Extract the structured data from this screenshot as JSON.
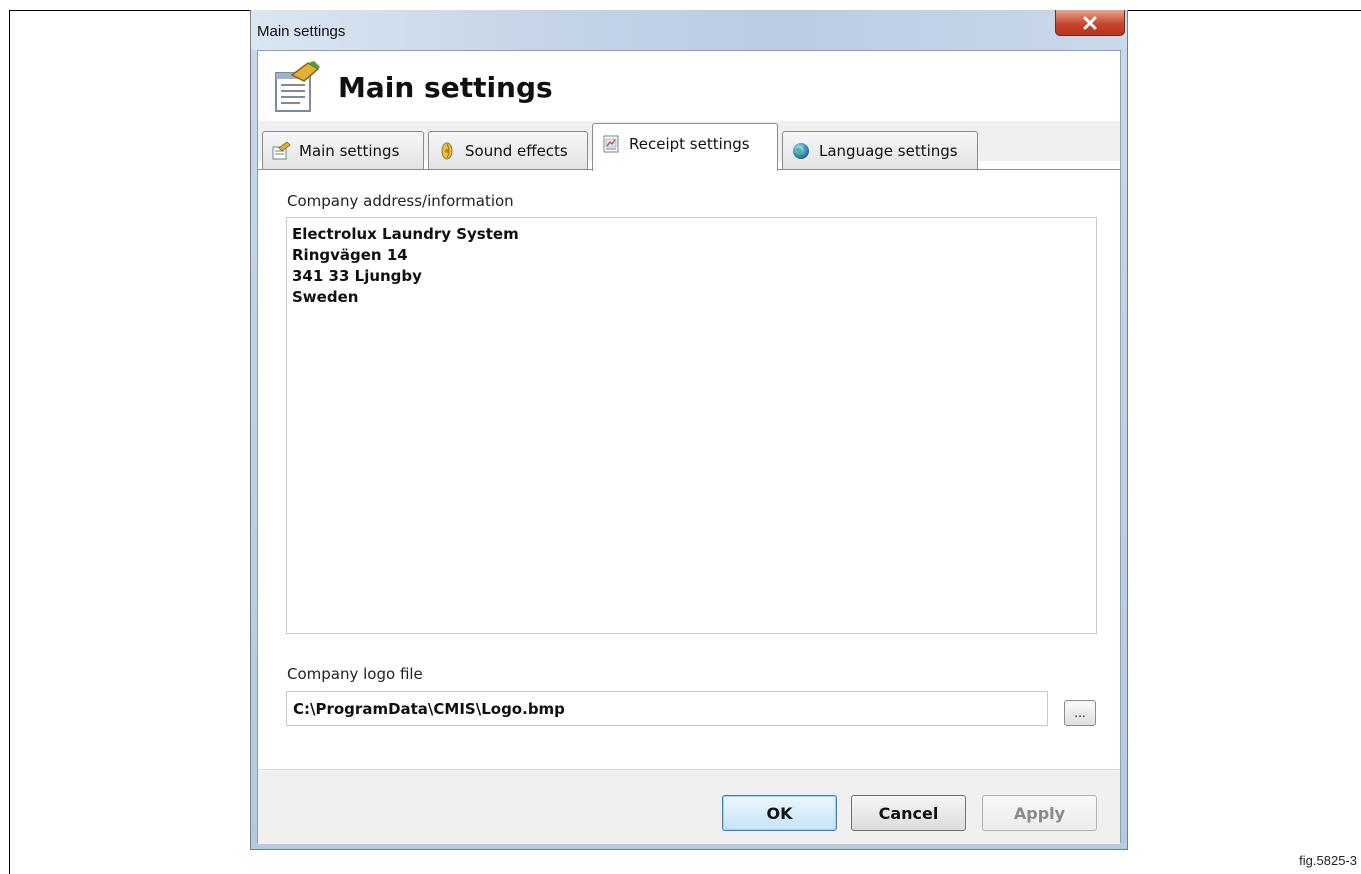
{
  "window": {
    "title": "Main settings"
  },
  "header": {
    "title": "Main settings",
    "icon": "document-settings-icon"
  },
  "tabs": [
    {
      "label": "Main settings",
      "icon": "settings-icon",
      "active": false
    },
    {
      "label": "Sound effects",
      "icon": "sound-icon",
      "active": false
    },
    {
      "label": "Receipt settings",
      "icon": "receipt-icon",
      "active": true
    },
    {
      "label": "Language settings",
      "icon": "globe-icon",
      "active": false
    }
  ],
  "receipt": {
    "address_label": "Company address/information",
    "address_lines": [
      "Electrolux Laundry System",
      "Ringvägen 14",
      "341 33 Ljungby",
      "Sweden"
    ],
    "logo_label": "Company logo file",
    "logo_path": "C:\\ProgramData\\CMIS\\Logo.bmp",
    "browse_label": "..."
  },
  "footer": {
    "ok_label": "OK",
    "cancel_label": "Cancel",
    "apply_label": "Apply",
    "apply_enabled": false
  },
  "figure": {
    "caption": "fig.5825-3"
  }
}
